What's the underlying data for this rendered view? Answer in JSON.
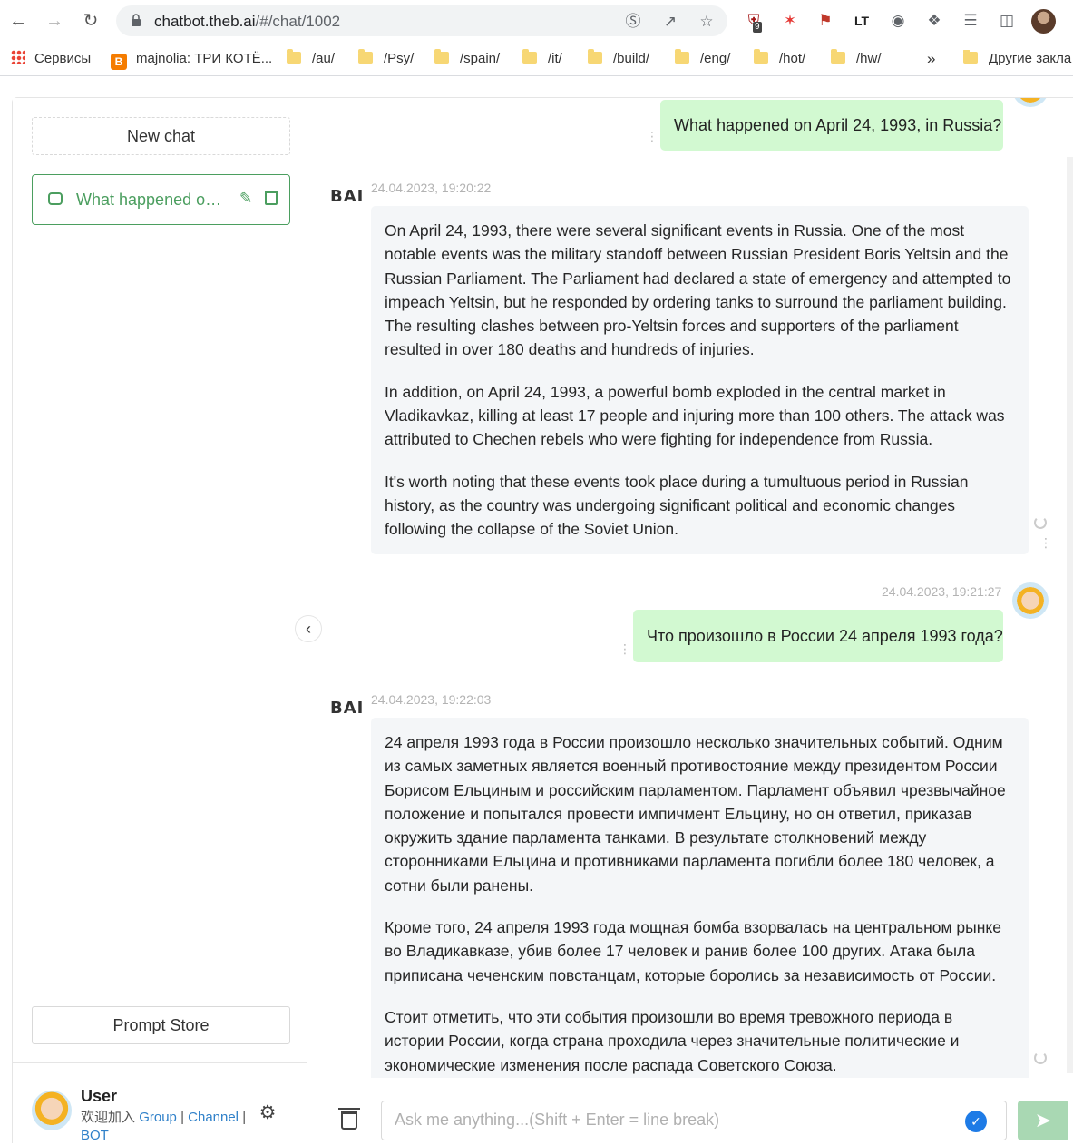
{
  "browser": {
    "url_host": "chatbot.theb.ai",
    "url_path": "/#/chat/1002",
    "ext_badge": "9",
    "bookmarks": [
      {
        "label": "Сервисы",
        "type": "apps"
      },
      {
        "label": "majnolia: ТРИ КОТЁ...",
        "type": "blogger"
      },
      {
        "label": "/au/",
        "type": "folder"
      },
      {
        "label": "/Psy/",
        "type": "folder"
      },
      {
        "label": "/spain/",
        "type": "folder"
      },
      {
        "label": "/it/",
        "type": "folder"
      },
      {
        "label": "/build/",
        "type": "folder"
      },
      {
        "label": "/eng/",
        "type": "folder"
      },
      {
        "label": "/hot/",
        "type": "folder"
      },
      {
        "label": "/hw/",
        "type": "folder"
      }
    ],
    "more_bookmarks": "»",
    "other_bookmarks": "Другие закла"
  },
  "sidebar": {
    "new_chat": "New chat",
    "chats": [
      {
        "title": "What happened on..."
      }
    ],
    "prompt_store": "Prompt Store",
    "user": {
      "name": "User",
      "join_text": "欢迎加入",
      "group": "Group",
      "sep": "|",
      "channel": "Channel",
      "bot": "BOT"
    }
  },
  "chat": {
    "messages": [
      {
        "role": "user",
        "text": "What happened on April 24, 1993,  in Russia?"
      },
      {
        "role": "bot",
        "logo": "BAI",
        "time": "24.04.2023, 19:20:22",
        "paragraphs": [
          "On April 24, 1993, there were several significant events in Russia. One of the most notable events was the military standoff between Russian President Boris Yeltsin and the Russian Parliament. The Parliament had declared a state of emergency and attempted to impeach Yeltsin, but he responded by ordering tanks to surround the parliament building. The resulting clashes between pro-Yeltsin forces and supporters of the parliament resulted in over 180 deaths and hundreds of injuries.",
          "In addition, on April 24, 1993, a powerful bomb exploded in the central market in Vladikavkaz, killing at least 17 people and injuring more than 100 others. The attack was attributed to Chechen rebels who were fighting for independence from Russia.",
          "It's worth noting that these events took place during a tumultuous period in Russian history, as the country was undergoing significant political and economic changes following the collapse of the Soviet Union."
        ]
      },
      {
        "role": "user",
        "time": "24.04.2023, 19:21:27",
        "text": "Что произошло в России 24 апреля 1993 года?"
      },
      {
        "role": "bot",
        "logo": "BAI",
        "time": "24.04.2023, 19:22:03",
        "paragraphs": [
          "24 апреля 1993 года в России произошло несколько значительных событий. Одним из самых заметных является военный противостояние между президентом России Борисом Ельциным и российским парламентом. Парламент объявил чрезвычайное положение и попытался провести импичмент Ельцину, но он ответил, приказав окружить здание парламента танками. В результате столкновений между сторонниками Ельцина и противниками парламента погибли более 180 человек, а сотни были ранены.",
          "Кроме того, 24 апреля 1993 года мощная бомба взорвалась на центральном рынке во Владикавказе, убив более 17 человек и ранив более 100 других. Атака была приписана чеченским повстанцам, которые боролись за независимость от России.",
          "Стоит отметить, что эти события произошли во время тревожного периода в истории России, когда страна проходила через значительные политические и экономические изменения после распада Советского Союза."
        ]
      }
    ]
  },
  "input": {
    "placeholder": "Ask me anything...(Shift + Enter = line break)",
    "value": ""
  },
  "colors": {
    "accent": "#4b9e5f",
    "user_bubble": "#d2f9d1",
    "bot_bubble": "#f4f6f8",
    "link": "#2f80c9",
    "send": "#a9d8b3"
  }
}
